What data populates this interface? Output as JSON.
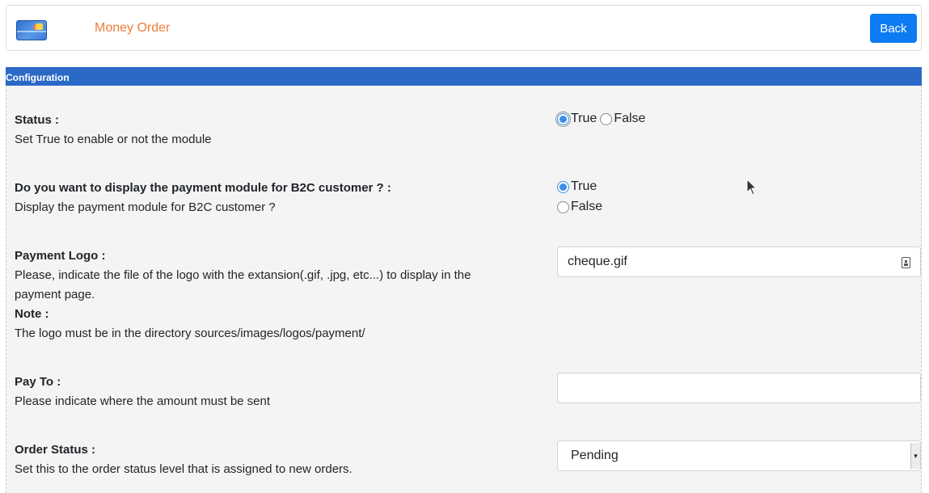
{
  "header": {
    "logo_icon": "credit-card-icon",
    "title": "Money Order",
    "back_label": "Back",
    "title_color": "#f07c3b",
    "button_color": "#0d7bf2"
  },
  "config": {
    "section_title": "Configuration",
    "bar_color": "#2a6ac6"
  },
  "fields": {
    "status": {
      "label": "Status :",
      "description": "Set True to enable or not the module",
      "options": [
        "True",
        "False"
      ],
      "selected": "True"
    },
    "b2c": {
      "label": "Do you want to display the payment module for B2C customer ? :",
      "description": "Display the payment module for B2C customer ?",
      "options": [
        "True",
        "False"
      ],
      "selected": "True"
    },
    "payment_logo": {
      "label": "Payment Logo :",
      "description_line1": "Please, indicate the file of the logo with the extansion(.gif, .jpg, etc...) to display in the",
      "description_line2": "payment page.",
      "note_label": "Note :",
      "note_text": "The logo must be in the directory sources/images/logos/payment/",
      "value": "cheque.gif"
    },
    "pay_to": {
      "label": "Pay To :",
      "description": "Please indicate where the amount must be sent",
      "value": ""
    },
    "order_status": {
      "label": "Order Status :",
      "description": "Set this to the order status level that is assigned to new orders.",
      "selected": "Pending"
    }
  }
}
